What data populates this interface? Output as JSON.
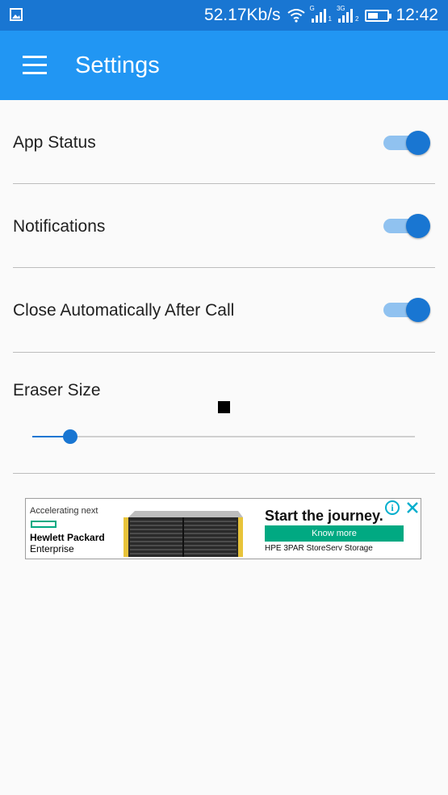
{
  "status_bar": {
    "network_speed": "52.17Kb/s",
    "sim1_label": "G",
    "sim1_slot": "1",
    "sim2_label": "3G",
    "sim2_slot": "2",
    "time": "12:42",
    "battery_level": 0.6,
    "icons": [
      "gallery-icon",
      "wifi-icon",
      "signal-icon",
      "battery-icon"
    ]
  },
  "app_bar": {
    "title": "Settings",
    "menu_icon": "hamburger-menu-icon"
  },
  "settings": [
    {
      "label": "App Status",
      "enabled": true
    },
    {
      "label": "Notifications",
      "enabled": true
    },
    {
      "label": "Close Automatically After Call",
      "enabled": true
    }
  ],
  "eraser": {
    "label": "Eraser Size",
    "slider_value": 0.1
  },
  "ad": {
    "tagline": "Accelerating next",
    "brand_line1": "Hewlett Packard",
    "brand_line2": "Enterprise",
    "headline": "Start the journey.",
    "cta": "Know more",
    "product": "HPE 3PAR StoreServ Storage",
    "info_glyph": "i",
    "colors": {
      "brand_green": "#01a982",
      "info_cyan": "#00aecd"
    }
  },
  "colors": {
    "status_bar": "#1976d2",
    "app_bar": "#2196f3",
    "accent": "#1976d2",
    "switch_track": "#90c2f0"
  }
}
